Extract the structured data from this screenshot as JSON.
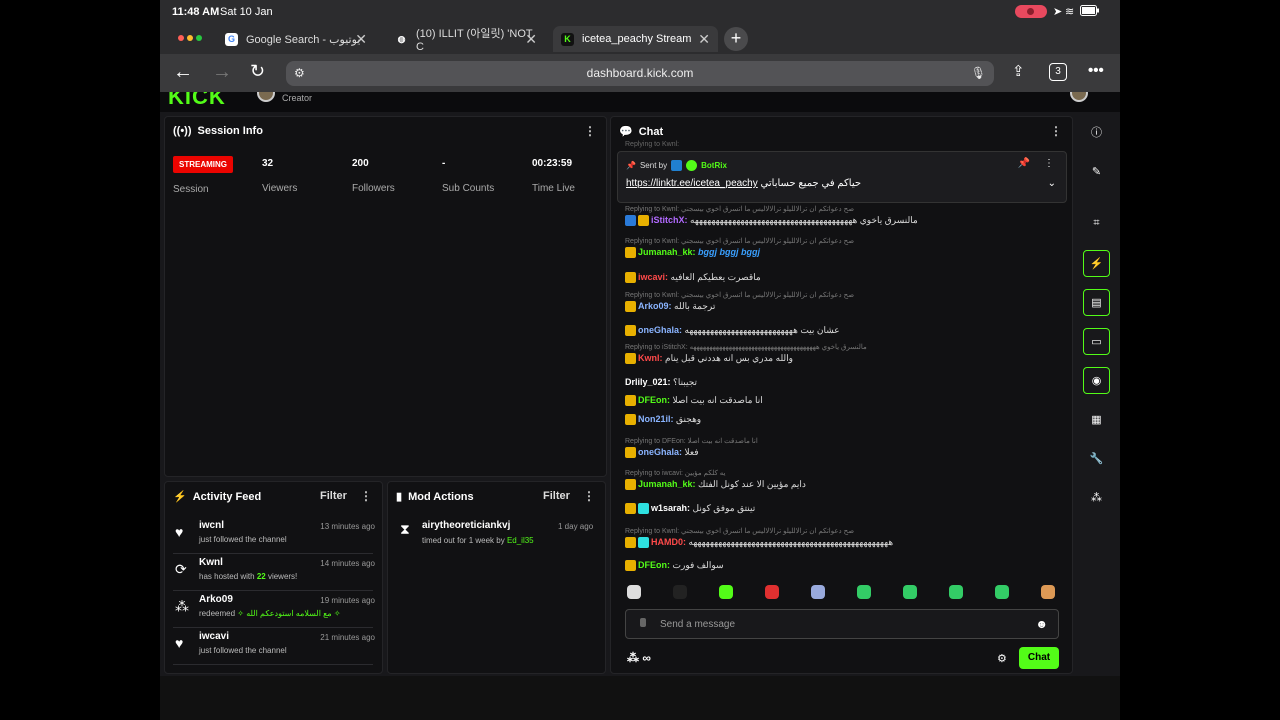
{
  "status": {
    "time": "11:48 AM",
    "date": "Sat 10 Jan"
  },
  "tabs": [
    {
      "title": "Google Search - يوتيوب",
      "favicon": "google-icon"
    },
    {
      "title": "(10) ILLIT (아일릿) 'NOT C",
      "favicon": "globe-icon"
    },
    {
      "title": "icetea_peachy Stream - K",
      "favicon": "kick-icon"
    }
  ],
  "url": "dashboard.kick.com",
  "tab_count": "3",
  "header": {
    "logo": "KICK",
    "creator_label": "Creator"
  },
  "session": {
    "title": "Session Info",
    "badge": "STREAMING",
    "label": "Session",
    "stats": [
      {
        "value": "32",
        "label": "Viewers"
      },
      {
        "value": "200",
        "label": "Followers"
      },
      {
        "value": "-",
        "label": "Sub Counts"
      },
      {
        "value": "00:23:59",
        "label": "Time Live"
      }
    ]
  },
  "activity": {
    "title": "Activity Feed",
    "filter": "Filter",
    "items": [
      {
        "name": "iwcnl",
        "time": "13 minutes ago",
        "desc": "just followed the channel",
        "icon": "heart-icon"
      },
      {
        "name": "Kwnl",
        "time": "14 minutes ago",
        "desc_pre": "has hosted with ",
        "desc_num": "22",
        "desc_post": " viewers!",
        "icon": "host-icon"
      },
      {
        "name": "Arko09",
        "time": "19 minutes ago",
        "desc_pre": "redeemed ",
        "desc_green": "✧ مع السلامه استودعكم الله ✧",
        "icon": "points-icon"
      },
      {
        "name": "iwcavi",
        "time": "21 minutes ago",
        "desc": "just followed the channel",
        "icon": "heart-icon"
      }
    ]
  },
  "mod": {
    "title": "Mod Actions",
    "filter": "Filter",
    "name": "airytheoreticiankvj",
    "time": "1 day ago",
    "desc_pre": "timed out for 1 week by ",
    "desc_by": "Ed_il35"
  },
  "chat": {
    "title": "Chat",
    "pinned_by_label": "Sent by",
    "pinned_by": "BotRix",
    "pinned_link": "https://linktr.ee/icetea_peachy",
    "pinned_text": " حياكم في جميع حساباتي ",
    "reply_top": "Replying to Kwnl:",
    "messages": [
      {
        "reply": "Replying to Kwnl: صح دعواتكم ان ترالالليلو ترالالاليس ما اتسرق اخوي بيسجني",
        "user": "iStitchX",
        "color": "#b26aff",
        "text": "مالنسرق ياخوي هههههههههههههههههههههههههههههههههههههههه",
        "badges": [
          "blue",
          "crown"
        ]
      },
      {
        "reply": "Replying to Kwnl: صح دعواتكم ان ترالالليلو ترالالاليس ما اتسرق اخوي بيسجني",
        "user": "Jumanah_kk",
        "color": "#53fc18",
        "text": "bggj bggj bggj",
        "textcolor": "#3aa0ff",
        "badges": [
          "crown"
        ]
      },
      {
        "user": "iwcavi",
        "color": "#ff4a4a",
        "text": "ماقصرت يعطيكم العافيه",
        "badges": [
          "crown"
        ]
      },
      {
        "reply": "Replying to Kwnl: صح دعواتكم ان ترالالليلو ترالالاليس ما اتسرق اخوي بيسجني",
        "user": "Arko09",
        "color": "#8ab4ff",
        "text": "ترجمة بالله",
        "badges": [
          "crown"
        ]
      },
      {
        "user": "oneGhala",
        "color": "#8ab4ff",
        "text": "عشان بيت ههههههههههههههههههههههههههه",
        "badges": [
          "crown"
        ]
      },
      {
        "reply": "Replying to iStitchX: مالنسرق ياخوي هههههههههههههههههههههههههههههههههههههههه",
        "user": "Kwnl",
        "color": "#ff4a4a",
        "text": "والله مدري بس انه هددني قبل ينام",
        "badges": [
          "crown"
        ]
      },
      {
        "user": "Drlily_021",
        "color": "#ffffff",
        "text": "تجيبنا؟",
        "badges": []
      },
      {
        "user": "DFEon",
        "color": "#53fc18",
        "text": "انا ماصدقت انه بيت اصلا",
        "badges": [
          "crown"
        ]
      },
      {
        "user": "Non21il",
        "color": "#8ab4ff",
        "text": "وهجنق",
        "badges": [
          "crown"
        ]
      },
      {
        "reply": "Replying to DFEon: انا ماصدقت انه بيت اصلا",
        "user": "oneGhala",
        "color": "#8ab4ff",
        "text": "فعلا",
        "badges": [
          "crown"
        ]
      },
      {
        "reply": "Replying to iwcavi: يه كلكم مؤيين",
        "user": "Jumanah_kk",
        "color": "#53fc18",
        "text": "دايم مؤيين الا عند كونل الفتك",
        "badges": [
          "crown"
        ]
      },
      {
        "user": "w1sarah",
        "color": "#ffffff",
        "text": "تينتق موفق كونل",
        "badges": [
          "crown",
          "cyan"
        ]
      },
      {
        "reply": "Replying to Kwnl: صح دعواتكم ان ترالالليلو ترالالاليس ما اتسرق اخوي بيسجني",
        "user": "HAMD0",
        "color": "#ff4a4a",
        "text": "ههههههههههههههههههههههههههههههههههههههههههههههههه",
        "badges": [
          "crown",
          "cyan"
        ]
      },
      {
        "user": "DFEon",
        "color": "#53fc18",
        "text": "سوالف فورت",
        "badges": [
          "crown"
        ]
      }
    ],
    "input_placeholder": "Send a message",
    "send_label": "Chat",
    "points": "∞"
  },
  "colors": {
    "accent": "#53fc18",
    "live": "#eb0400"
  }
}
